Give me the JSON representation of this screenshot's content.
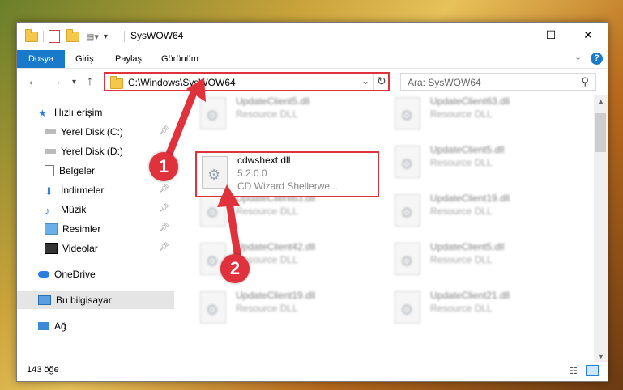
{
  "titlebar": {
    "title": "SysWOW64"
  },
  "ribbon": {
    "tabs": [
      "Dosya",
      "Giriş",
      "Paylaş",
      "Görünüm"
    ]
  },
  "address": {
    "path": "C:\\Windows\\SysWOW64"
  },
  "search": {
    "placeholder": "Ara: SysWOW64"
  },
  "sidebar": {
    "items": [
      {
        "label": "Hızlı erişim",
        "icon": "star-icon"
      },
      {
        "label": "Yerel Disk (C:)",
        "icon": "drive-icon",
        "pinned": true
      },
      {
        "label": "Yerel Disk (D:)",
        "icon": "drive-icon"
      },
      {
        "label": "Belgeler",
        "icon": "documents-icon"
      },
      {
        "label": "İndirmeler",
        "icon": "download-icon",
        "pinned": true
      },
      {
        "label": "Müzik",
        "icon": "music-icon",
        "pinned": true
      },
      {
        "label": "Resimler",
        "icon": "pictures-icon",
        "pinned": true
      },
      {
        "label": "Videolar",
        "icon": "video-icon",
        "pinned": true
      },
      {
        "label": "OneDrive",
        "icon": "cloud-icon"
      },
      {
        "label": "Bu bilgisayar",
        "icon": "computer-icon",
        "selected": true
      },
      {
        "label": "Ağ",
        "icon": "network-icon"
      }
    ]
  },
  "files": [
    {
      "name": "UpdateClient5.dll",
      "type": "Resource DLL"
    },
    {
      "name": "UpdateClient63.dll",
      "type": "Resource DLL"
    },
    {
      "name": "cdwshext.dll",
      "version": "5.2.0.0",
      "desc": "CD Wizard Shellerwe..."
    },
    {
      "name": "UpdateClient5.dll",
      "type": "Resource DLL"
    },
    {
      "name": "UpdateClient63.dll",
      "type": "Resource DLL"
    },
    {
      "name": "UpdateClient19.dll",
      "type": "Resource DLL"
    },
    {
      "name": "UpdateClient42.dll",
      "type": "Resource DLL"
    },
    {
      "name": "UpdateClient5.dll",
      "type": "Resource DLL"
    },
    {
      "name": "UpdateClient19.dll",
      "type": "Resource DLL"
    },
    {
      "name": "UpdateClient21.dll",
      "type": "Resource DLL"
    }
  ],
  "status": {
    "count": "143 öğe"
  },
  "annotations": {
    "badge1": "1",
    "badge2": "2"
  }
}
